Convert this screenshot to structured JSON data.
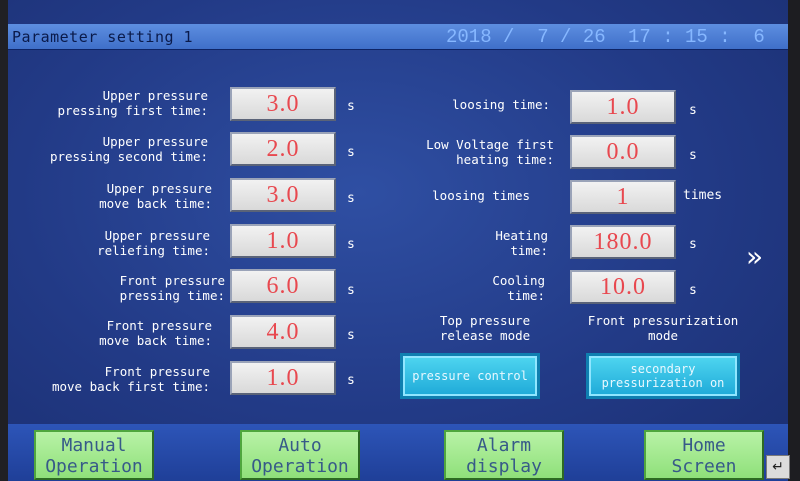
{
  "header": {
    "title": "Parameter setting 1",
    "date": "2018 /  7 / 26",
    "time": "17 : 15 :  6"
  },
  "left_params": [
    {
      "label": "Upper pressure\npressing first time:",
      "value": "3.0",
      "unit": "s"
    },
    {
      "label": "Upper pressure\npressing second time:",
      "value": "2.0",
      "unit": "s"
    },
    {
      "label": "Upper pressure\nmove back time:",
      "value": "3.0",
      "unit": "s"
    },
    {
      "label": "Upper pressure\nreliefing time:",
      "value": "1.0",
      "unit": "s"
    },
    {
      "label": "Front pressure\npressing time:",
      "value": "6.0",
      "unit": "s"
    },
    {
      "label": "Front pressure\nmove back time:",
      "value": "4.0",
      "unit": "s"
    },
    {
      "label": "Front pressure\nmove back first time:",
      "value": "1.0",
      "unit": "s"
    }
  ],
  "right_params": [
    {
      "label": "loosing time:",
      "value": "1.0",
      "unit": "s"
    },
    {
      "label": "Low Voltage first\nheating time:",
      "value": "0.0",
      "unit": "s"
    },
    {
      "label": "loosing times",
      "value": "1",
      "unit": "times"
    },
    {
      "label": "Heating\ntime:",
      "value": "180.0",
      "unit": "s"
    },
    {
      "label": "Cooling\ntime:",
      "value": "10.0",
      "unit": "s"
    }
  ],
  "modes": {
    "top_label": "Top pressure\nrelease mode",
    "top_button": "pressure control",
    "front_label": "Front pressurization\nmode",
    "front_button": "secondary\npressurization on"
  },
  "nav": {
    "next_page": "»",
    "manual": "Manual\nOperation",
    "auto": "Auto\nOperation",
    "alarm": "Alarm\ndisplay",
    "home": "Home\nScreen",
    "return_icon": "↵"
  }
}
